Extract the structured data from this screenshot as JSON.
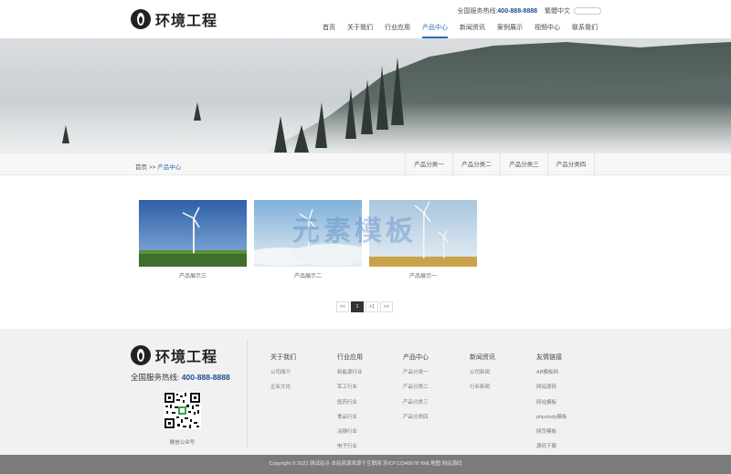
{
  "header": {
    "logo_text": "环境工程",
    "hotline_label": "全国服务热线:",
    "hotline_number": "400-888-8888",
    "lang_label": "繁體中文",
    "nav": [
      {
        "label": "首页"
      },
      {
        "label": "关于我们"
      },
      {
        "label": "行业应用"
      },
      {
        "label": "产品中心",
        "active": true
      },
      {
        "label": "新闻资讯"
      },
      {
        "label": "案例展示"
      },
      {
        "label": "视频中心"
      },
      {
        "label": "联系我们"
      }
    ]
  },
  "breadcrumb": {
    "home": "首页",
    "sep": ">>",
    "current": "产品中心"
  },
  "categories": [
    "产品分类一",
    "产品分类二",
    "产品分类三",
    "产品分类四"
  ],
  "products": [
    {
      "caption": "产品展示三"
    },
    {
      "caption": "产品展示二"
    },
    {
      "caption": "产品展示一"
    }
  ],
  "watermark": "元素模板",
  "pager": [
    "<<",
    "1",
    ">1",
    ">>"
  ],
  "footer": {
    "logo_text": "环境工程",
    "hotline_label": "全国服务热线:",
    "hotline_number": "400-888-8888",
    "qr_caption": "微信公众号",
    "columns": [
      {
        "title": "关于我们",
        "links": [
          "公司简介",
          "企业文化"
        ]
      },
      {
        "title": "行业应用",
        "links": [
          "新能源行业",
          "军工行业",
          "医药行业",
          "食品行业",
          "冶钢行业",
          "电子行业"
        ]
      },
      {
        "title": "产品中心",
        "links": [
          "产品分类一",
          "产品分类二",
          "产品分类三",
          "产品分类四"
        ]
      },
      {
        "title": "新闻资讯",
        "links": [
          "公司新闻",
          "行业新闻"
        ]
      },
      {
        "title": "友情链接",
        "links": [
          "AB模板网",
          "网站源码",
          "网站模板",
          "phpstudy模板",
          "网页模板",
          "源码下载"
        ]
      }
    ]
  },
  "copyright": "Copyright © 2022 测试站点 本站资源来源于互联网 苏ICP12345678 XML地图 网站源码",
  "colors": {
    "accent": "#2a6fb0",
    "hotline": "#1a4d8c",
    "footer_bg": "#f1f1f1",
    "copyright_bg": "#7b7b7b"
  }
}
